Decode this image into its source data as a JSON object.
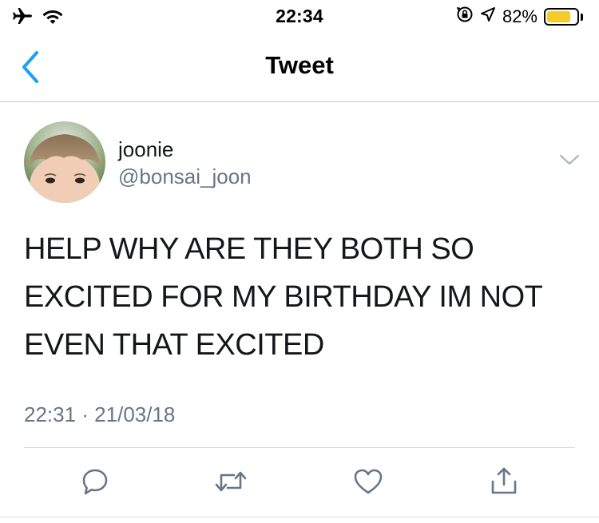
{
  "status_bar": {
    "time": "22:34",
    "battery_percent": "82%",
    "battery_level": 0.82,
    "icons": [
      "airplane-icon",
      "wifi-icon",
      "orientation-lock-icon",
      "location-icon",
      "battery-icon"
    ]
  },
  "nav": {
    "title": "Tweet",
    "back_icon": "chevron-left-icon"
  },
  "tweet": {
    "display_name": "joonie",
    "handle": "@bonsai_joon",
    "text": "HELP WHY ARE THEY BOTH SO EXCITED FOR MY BIRTHDAY IM NOT EVEN THAT EXCITED",
    "timestamp": "22:31 · 21/03/18"
  },
  "actions": [
    "reply-icon",
    "retweet-icon",
    "like-icon",
    "share-icon"
  ],
  "colors": {
    "accent": "#1da1f2",
    "secondary_text": "#657786",
    "icon_gray": "#657786",
    "battery_yellow": "#f5cb2c",
    "divider": "#d7dbdf"
  }
}
